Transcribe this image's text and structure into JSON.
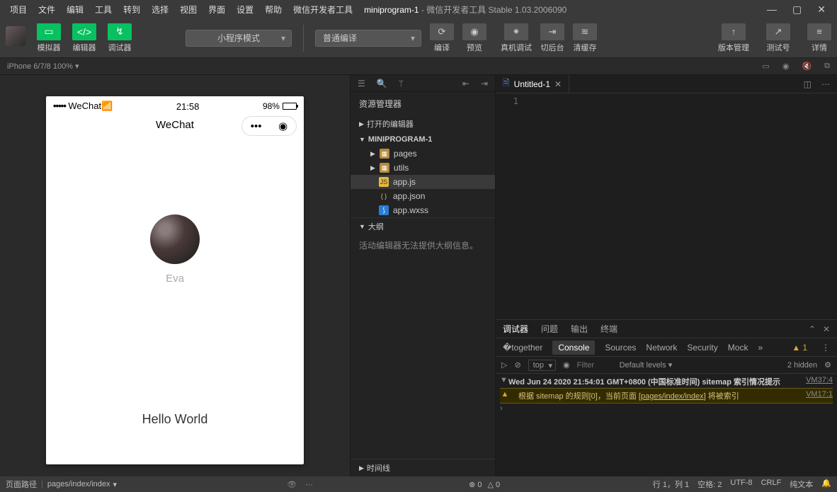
{
  "menubar": [
    "项目",
    "文件",
    "编辑",
    "工具",
    "转到",
    "选择",
    "视图",
    "界面",
    "设置",
    "帮助",
    "微信开发者工具"
  ],
  "title": {
    "project": "miniprogram-1",
    "suffix": " - 微信开发者工具 Stable 1.03.2006090"
  },
  "toolbar_btns": {
    "simulator": "模拟器",
    "editor": "编辑器",
    "debugger": "调试器"
  },
  "mode_select": "小程序模式",
  "compile_select": "普通编译",
  "actions": {
    "compile": "编译",
    "preview": "预览",
    "remote": "真机调试",
    "background": "切后台",
    "cache": "清缓存",
    "version": "版本管理",
    "testno": "测试号",
    "detail": "详情"
  },
  "devbar": {
    "device": "iPhone 6/7/8 100%"
  },
  "phone": {
    "carrier": "WeChat",
    "time": "21:58",
    "battery": "98%",
    "title": "WeChat",
    "name": "Eva",
    "hello": "Hello World"
  },
  "explorer": {
    "title": "资源管理器",
    "open_editors": "打开的编辑器",
    "project": "MINIPROGRAM-1",
    "items": {
      "pages": "pages",
      "utils": "utils",
      "appjs": "app.js",
      "appjson": "app.json",
      "appwxss": "app.wxss"
    },
    "outline": "大纲",
    "outline_msg": "活动编辑器无法提供大纲信息。",
    "timeline": "时间线"
  },
  "tab": {
    "name": "Untitled-1"
  },
  "gutter_line": "1",
  "debugger": {
    "tabs": {
      "debugger": "调试器",
      "problems": "问题",
      "output": "输出",
      "terminal": "终端"
    },
    "devtabs": {
      "console": "Console",
      "sources": "Sources",
      "network": "Network",
      "security": "Security",
      "mock": "Mock"
    },
    "warn_count": "1",
    "ctx": "top",
    "filter_ph": "Filter",
    "levels": "Default levels",
    "hidden": "2 hidden",
    "log1": {
      "text": "Wed Jun 24 2020 21:54:01 GMT+0800 (中国标准时间) sitemap 索引情况提示",
      "src": "VM37:4"
    },
    "log2": {
      "prefix": "根据 sitemap 的规则[0]，当前页面 [",
      "link": "pages/index/index",
      "suffix": "] 将被索引",
      "src": "VM17:1"
    }
  },
  "footer": {
    "path_label": "页面路径",
    "path": "pages/index/index",
    "warn_zero": "0",
    "err_zero": "0",
    "line": "行 1，列 1",
    "spaces": "空格: 2",
    "enc": "UTF-8",
    "eol": "CRLF",
    "lang": "纯文本"
  }
}
